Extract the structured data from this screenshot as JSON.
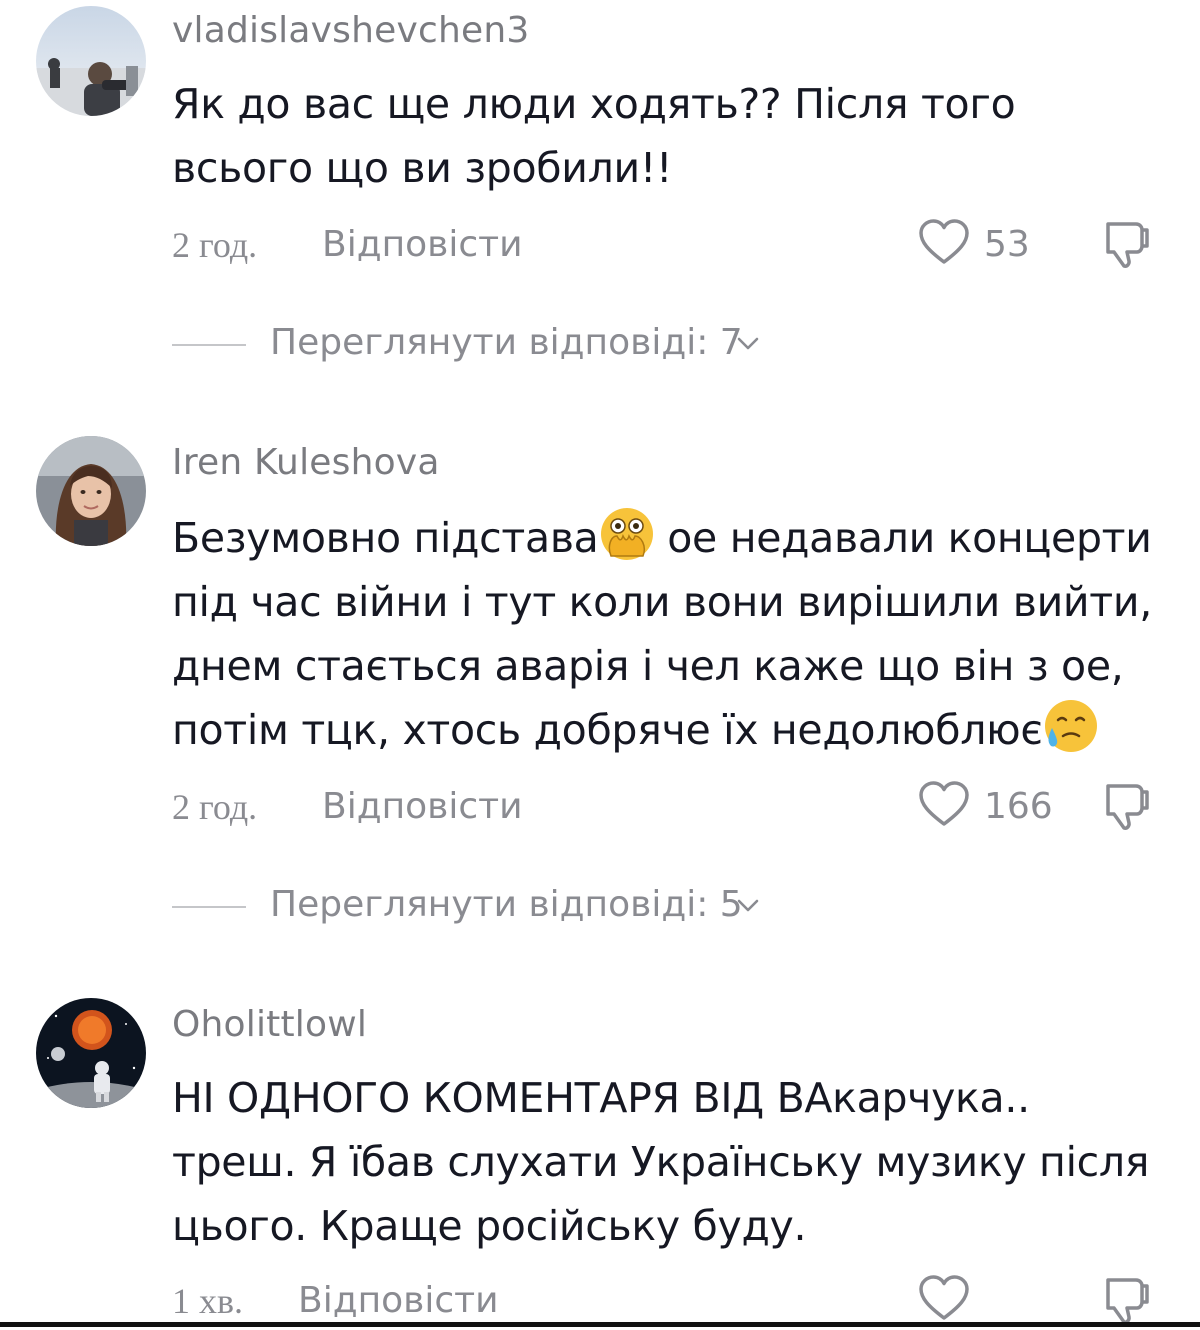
{
  "comments": [
    {
      "username": "vladislavshevchen3",
      "lines": [
        "Як до вас ще люди ходять?? Після того",
        "всього що ви зробили!!"
      ],
      "time": "2 год.",
      "reply_label": "Відповісти",
      "likes": "53",
      "view_replies": "Переглянути відповіді: 7"
    },
    {
      "username": "Iren Kuleshova",
      "line1_part1": "Безумовно підстава",
      "line1_part2": " ое недавали концерти",
      "line2": "під час війни і тут коли вони вирішили вийти,",
      "line3": "днем стається аварія і чел каже що він з ое,",
      "line4": "потім тцк, хтось добряче їх недолюблює",
      "time": "2 год.",
      "reply_label": "Відповісти",
      "likes": "166",
      "view_replies": "Переглянути відповіді: 5"
    },
    {
      "username": "Oholittlowl",
      "lines": [
        "НІ ОДНОГО КОМЕНТАРЯ ВІД ВАкарчука..",
        "треш. Я їбав слухати Українську музику після",
        "цього. Краще російську буду."
      ],
      "time": "1 хв.",
      "reply_label": "Відповісти"
    }
  ],
  "icons": {
    "like": "heart-outline-icon",
    "dislike": "thumbs-down-outline-icon",
    "emoji_1": "face-with-open-eyes-and-hand-over-mouth-emoji",
    "emoji_2": "sad-but-relieved-face-emoji",
    "chevron": "chevron-down-icon"
  },
  "colors": {
    "text": "#161823",
    "secondary": "#8a8b91",
    "username": "#7a7b80"
  }
}
